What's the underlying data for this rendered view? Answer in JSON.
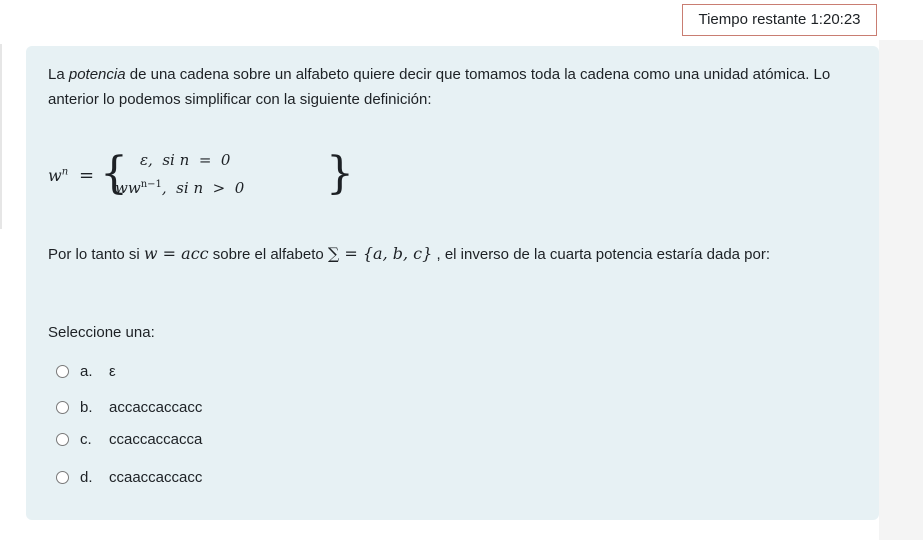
{
  "timer": {
    "text": "Tiempo restante 1:20:23"
  },
  "question": {
    "intro_part1": "La ",
    "intro_emphasis": "potencia",
    "intro_part2": " de una cadena sobre un alfabeto quiere decir que tomamos toda la cadena como una unidad atómica. Lo anterior lo podemos simplificar con la siguiente definición:",
    "formula": {
      "lhs_base": "w",
      "lhs_exp": "n",
      "equals": "=",
      "case1": "ε,  si n  =  0",
      "case2_base": "ww",
      "case2_exp": "n−1",
      "case2_rest": ",  si n  >  0"
    },
    "prompt_part1": "Por lo tanto si ",
    "prompt_math1": "w = acc",
    "prompt_part2": " sobre el alfabeto ",
    "prompt_math2": "∑ = {a, b, c}",
    "prompt_part3": " , el inverso de la cuarta potencia   estaría dada por:"
  },
  "select_label": "Seleccione una:",
  "options": [
    {
      "letter": "a.",
      "text": "ε"
    },
    {
      "letter": "b.",
      "text": "accaccaccacc"
    },
    {
      "letter": "c.",
      "text": "ccaccaccacca"
    },
    {
      "letter": "d.",
      "text": "ccaaccaccacc"
    }
  ]
}
